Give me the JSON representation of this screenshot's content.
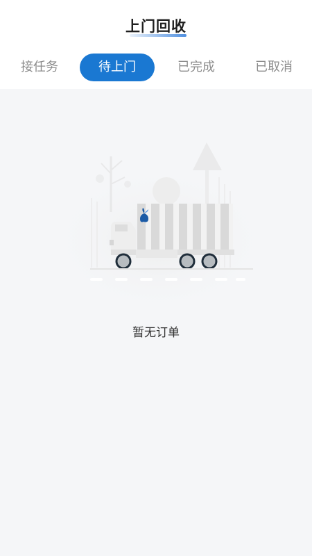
{
  "header": {
    "title": "上门回收"
  },
  "tabs": [
    {
      "label": "接任务",
      "active": false
    },
    {
      "label": "待上门",
      "active": true
    },
    {
      "label": "已完成",
      "active": false
    },
    {
      "label": "已取消",
      "active": false
    }
  ],
  "empty_state": {
    "message": "暂无订单",
    "illustration": "garbage-truck-icon"
  },
  "colors": {
    "accent": "#1a78d2",
    "background": "#f5f6f8",
    "tab_inactive": "#8c8c8c",
    "logo": "#1a5aa6"
  }
}
